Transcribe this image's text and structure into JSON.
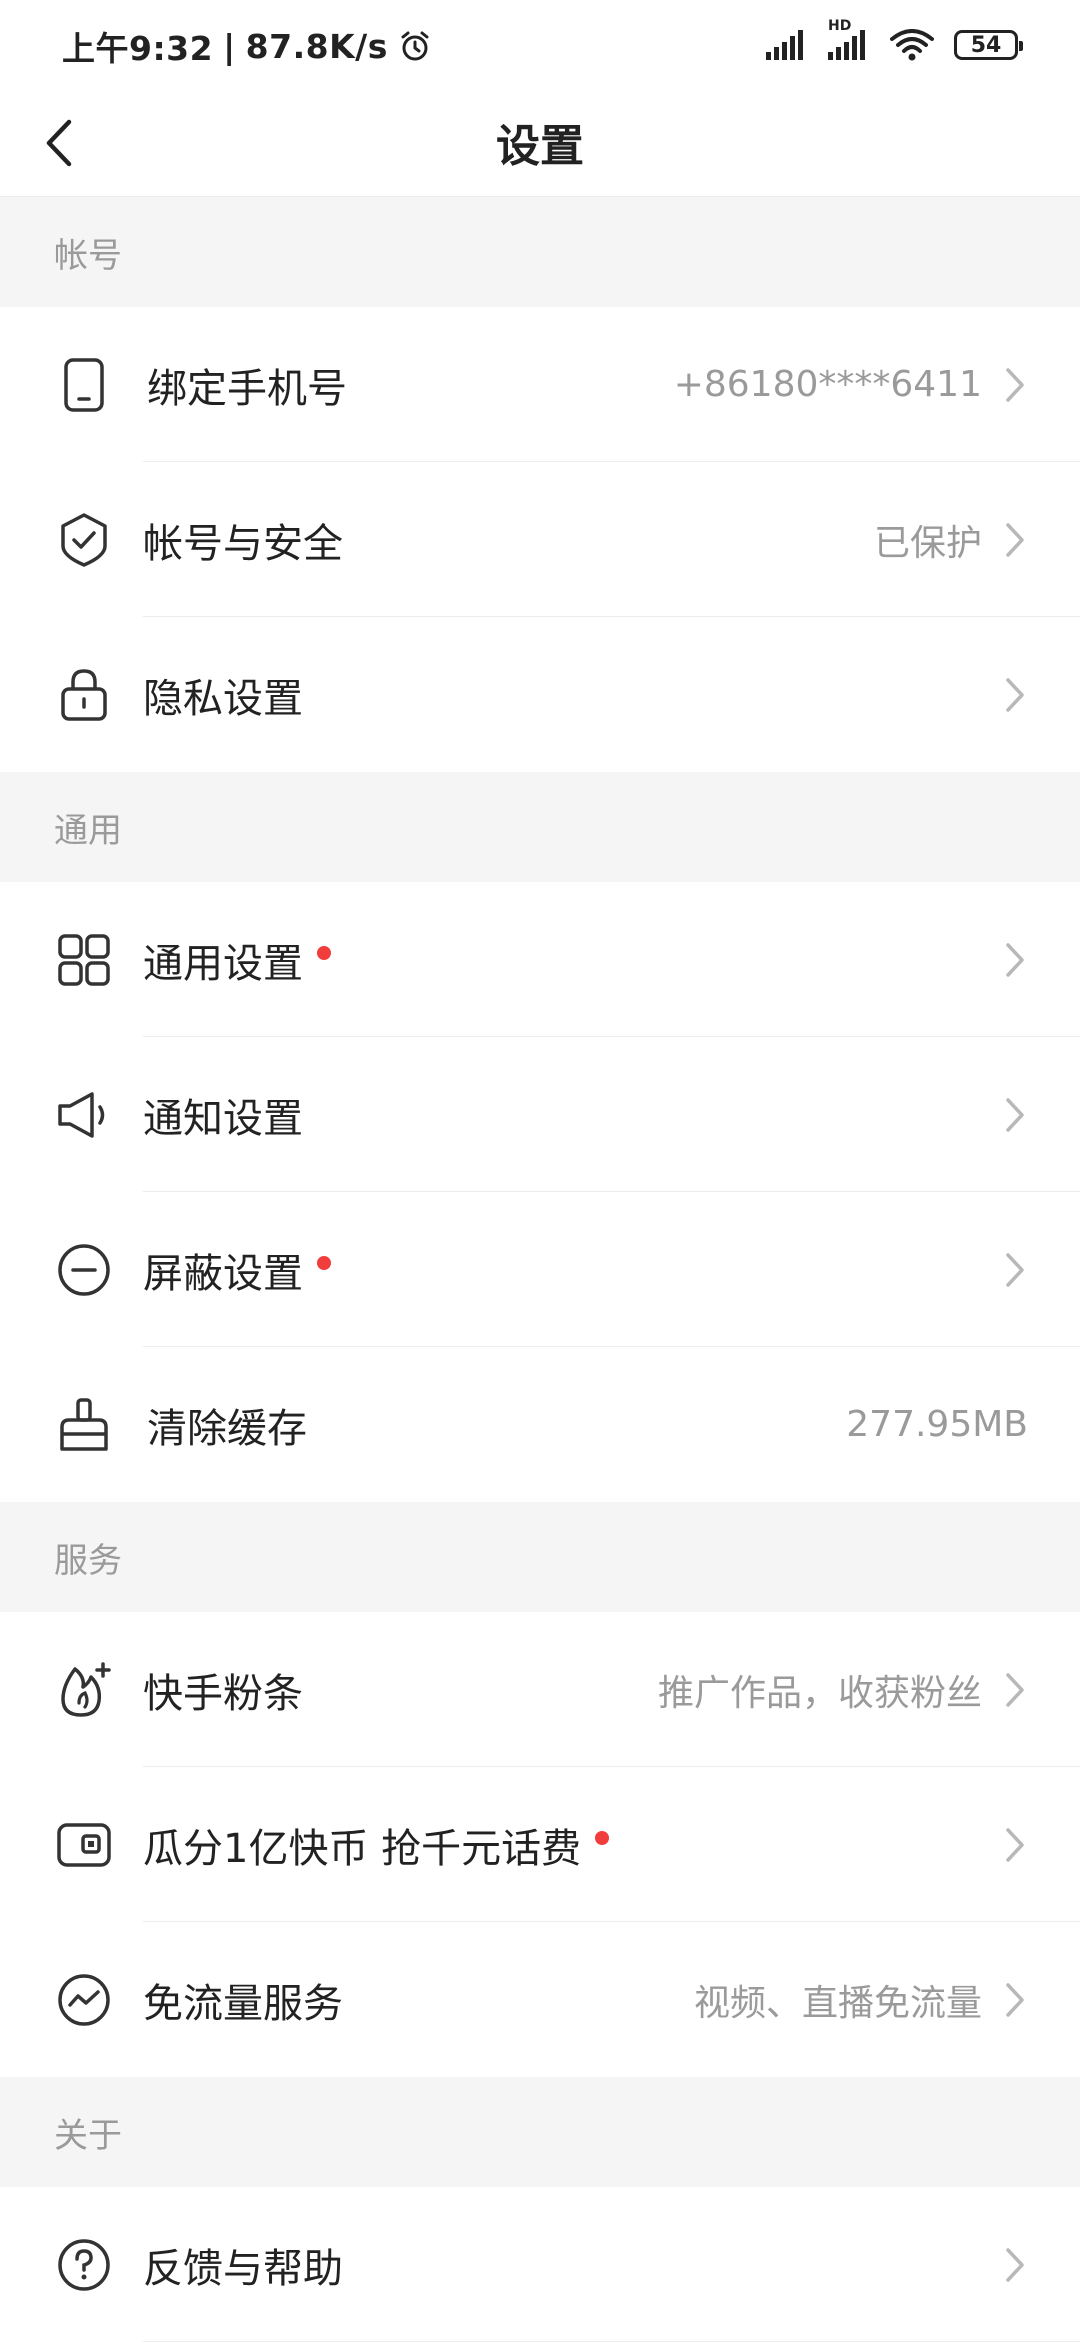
{
  "status_bar": {
    "time": "上午9:32",
    "separator": "|",
    "speed": "87.8K/s",
    "hd_label": "HD",
    "battery": "54"
  },
  "header": {
    "title": "设置",
    "back_icon": "chevron-left-icon"
  },
  "sections": {
    "account": {
      "title": "帐号",
      "items": [
        {
          "label": "绑定手机号",
          "value": "+86180****6411",
          "icon": "phone-icon"
        },
        {
          "label": "帐号与安全",
          "value": "已保护",
          "icon": "shield-check-icon"
        },
        {
          "label": "隐私设置",
          "value": "",
          "icon": "lock-icon"
        }
      ]
    },
    "general": {
      "title": "通用",
      "items": [
        {
          "label": "通用设置",
          "value": "",
          "icon": "grid-icon",
          "dot": true
        },
        {
          "label": "通知设置",
          "value": "",
          "icon": "speaker-icon"
        },
        {
          "label": "屏蔽设置",
          "value": "",
          "icon": "block-icon",
          "dot": true
        },
        {
          "label": "清除缓存",
          "value": "277.95MB",
          "icon": "broom-icon"
        }
      ]
    },
    "service": {
      "title": "服务",
      "items": [
        {
          "label": "快手粉条",
          "value": "推广作品，收获粉丝",
          "icon": "fire-plus-icon"
        },
        {
          "label": "瓜分1亿快币 抢千元话费",
          "value": "",
          "icon": "wallet-icon",
          "dot": true
        },
        {
          "label": "免流量服务",
          "value": "视频、直播免流量",
          "icon": "traffic-icon"
        }
      ]
    },
    "about": {
      "title": "关于",
      "items": [
        {
          "label": "反馈与帮助",
          "value": "",
          "icon": "help-icon"
        }
      ]
    }
  },
  "colors": {
    "accent_dot": "#f23d3d",
    "section_bg": "#f5f5f5",
    "secondary_text": "#9a9a9a"
  }
}
